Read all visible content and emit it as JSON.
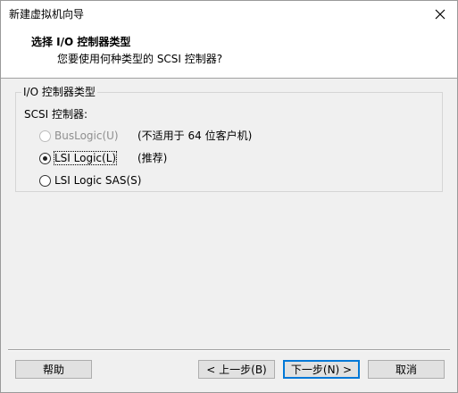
{
  "window": {
    "title": "新建虚拟机向导"
  },
  "header": {
    "title": "选择 I/O 控制器类型",
    "subtitle": "您要使用何种类型的 SCSI 控制器?"
  },
  "group": {
    "legend": "I/O 控制器类型",
    "scsi_label": "SCSI 控制器:",
    "options": [
      {
        "label": "BusLogic(U)",
        "note": "(不适用于 64 位客户机)",
        "selected": false,
        "enabled": false
      },
      {
        "label": "LSI Logic(L)",
        "note": "(推荐)",
        "selected": true,
        "enabled": true
      },
      {
        "label": "LSI Logic SAS(S)",
        "note": "",
        "selected": false,
        "enabled": true
      }
    ]
  },
  "buttons": {
    "help": "帮助",
    "back": "< 上一步(B)",
    "next": "下一步(N) >",
    "cancel": "取消"
  },
  "icons": {
    "close": "close-icon"
  }
}
